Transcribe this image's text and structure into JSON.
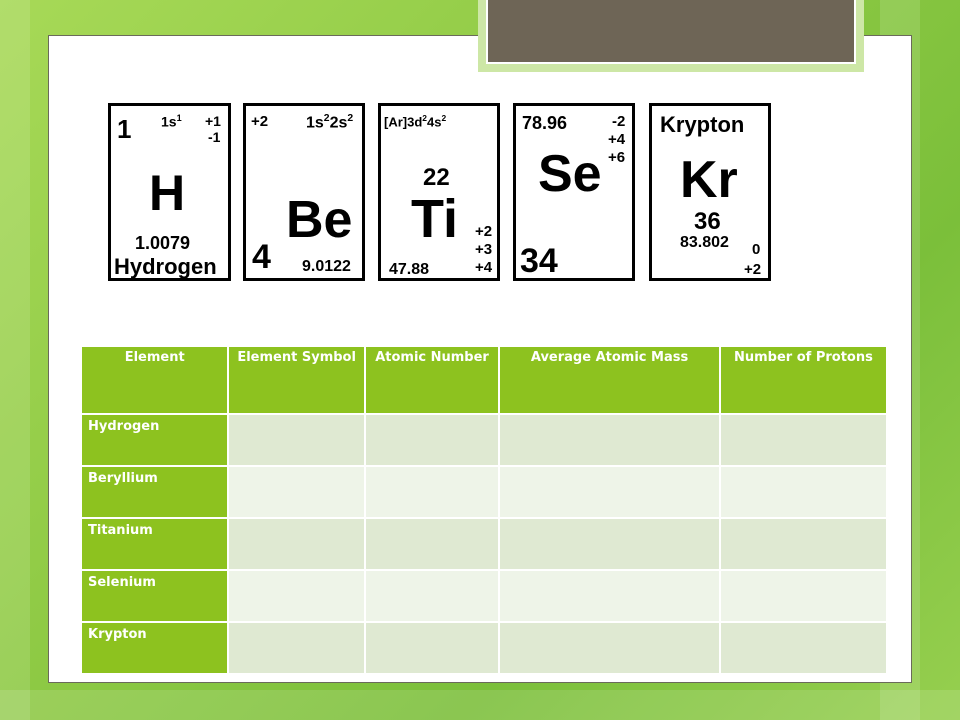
{
  "colors": {
    "header_green": "#8dc21f",
    "row_dark": "#dfe9d2",
    "row_light": "#eef4e8",
    "title_bar": "#6e6556"
  },
  "cards": {
    "hydrogen": {
      "number": "1",
      "config_base": "1s",
      "config_sup": "1",
      "charge_top": "+1",
      "charge_bottom": "-1",
      "symbol": "H",
      "mass": "1.0079",
      "name": "Hydrogen"
    },
    "beryllium": {
      "charge": "+2",
      "config_a": "1s",
      "config_a_sup": "2",
      "config_b": "2s",
      "config_b_sup": "2",
      "symbol": "Be",
      "number": "4",
      "mass": "9.0122"
    },
    "titanium": {
      "config_bracket": "[Ar]3d",
      "config_sup_a": "2",
      "config_mid": "4s",
      "config_sup_b": "2",
      "number": "22",
      "symbol": "Ti",
      "charge_a": "+2",
      "charge_b": "+3",
      "charge_c": "+4",
      "mass": "47.88"
    },
    "selenium": {
      "mass": "78.96",
      "charge_a": "-2",
      "charge_b": "+4",
      "charge_c": "+6",
      "symbol": "Se",
      "number": "34"
    },
    "krypton": {
      "name": "Krypton",
      "symbol": "Kr",
      "number": "36",
      "mass": "83.802",
      "charge_a": "0",
      "charge_b": "+2"
    }
  },
  "table": {
    "headers": [
      "Element",
      "Element Symbol",
      "Atomic Number",
      "Average Atomic Mass",
      "Number of Protons"
    ],
    "rows": [
      "Hydrogen",
      "Beryllium",
      "Titanium",
      "Selenium",
      "Krypton"
    ]
  }
}
